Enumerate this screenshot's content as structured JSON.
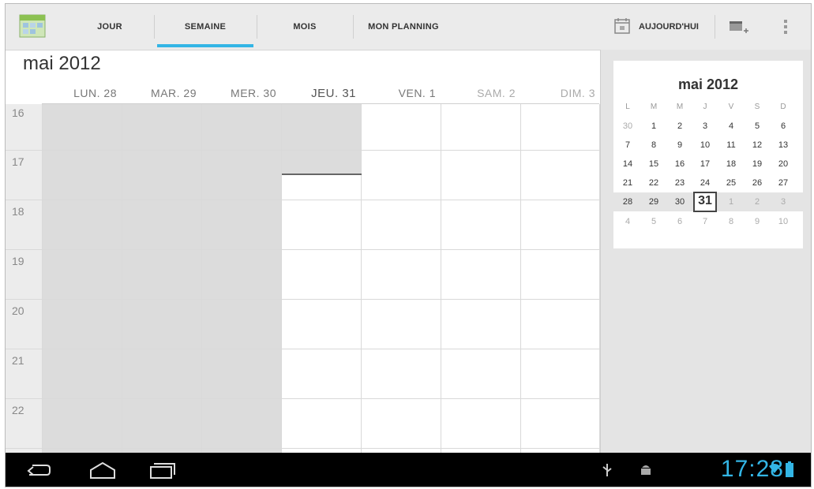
{
  "tabs": [
    "JOUR",
    "SEMAINE",
    "MOIS",
    "MON PLANNING"
  ],
  "toolbar": {
    "today_label": "AUJOURD'HUI"
  },
  "month_title": "mai 2012",
  "days": [
    {
      "label": "LUN. 28"
    },
    {
      "label": "MAR. 29"
    },
    {
      "label": "MER. 30"
    },
    {
      "label": "JEU. 31"
    },
    {
      "label": "VEN. 1"
    },
    {
      "label": "SAM. 2"
    },
    {
      "label": "DIM. 3"
    }
  ],
  "hours": [
    "16",
    "17",
    "18",
    "19",
    "20",
    "21",
    "22"
  ],
  "mini_calendar": {
    "title": "mai 2012",
    "weekday_headers": [
      "L",
      "M",
      "M",
      "J",
      "V",
      "S",
      "D"
    ],
    "weeks": [
      [
        "30",
        "1",
        "2",
        "3",
        "4",
        "5",
        "6"
      ],
      [
        "7",
        "8",
        "9",
        "10",
        "11",
        "12",
        "13"
      ],
      [
        "14",
        "15",
        "16",
        "17",
        "18",
        "19",
        "20"
      ],
      [
        "21",
        "22",
        "23",
        "24",
        "25",
        "26",
        "27"
      ],
      [
        "28",
        "29",
        "30",
        "31",
        "1",
        "2",
        "3"
      ],
      [
        "4",
        "5",
        "6",
        "7",
        "8",
        "9",
        "10"
      ]
    ],
    "today": "31"
  },
  "status_bar": {
    "time": "17:28"
  },
  "colors": {
    "accent": "#33b5e5",
    "past_shade": "#dcdcdc",
    "actionbar": "#ebebeb"
  },
  "icons": [
    "calendar-app-icon",
    "calendar-today-icon",
    "new-event-icon",
    "overflow-menu-icon",
    "back-icon",
    "home-icon",
    "recent-apps-icon",
    "usb-icon",
    "android-debug-icon",
    "wifi-icon",
    "battery-icon"
  ]
}
